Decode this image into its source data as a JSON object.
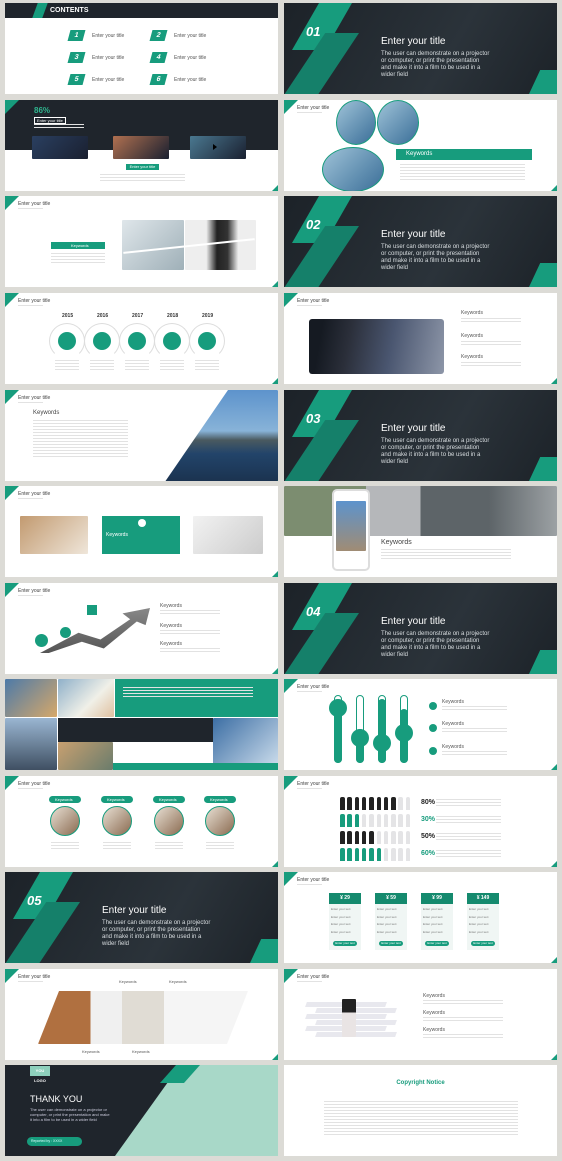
{
  "colors": {
    "accent": "#179c7d",
    "dark": "#1f252c",
    "background": "#dcdbd6"
  },
  "generic_title": "Enter your title",
  "keyword": "Keywords",
  "contents": {
    "header": "CONTENTS",
    "items": [
      {
        "n": "1",
        "label": "Enter your title"
      },
      {
        "n": "2",
        "label": "Enter your title"
      },
      {
        "n": "3",
        "label": "Enter your title"
      },
      {
        "n": "4",
        "label": "Enter your title"
      },
      {
        "n": "5",
        "label": "Enter your title"
      },
      {
        "n": "6",
        "label": "Enter your title"
      }
    ]
  },
  "sections": [
    {
      "number": "01",
      "title": "Enter your title",
      "body": "The user can demonstrate on a projector or computer, or print the presentation and make it into a film to be used in a wider field"
    },
    {
      "number": "02",
      "title": "Enter your title",
      "body": "The user can demonstrate on a projector or computer, or print the presentation and make it into a film to be used in a wider field"
    },
    {
      "number": "03",
      "title": "Enter your title",
      "body": "The user can demonstrate on a projector or computer, or print the presentation and make it into a film to be used in a wider field"
    },
    {
      "number": "04",
      "title": "Enter your title",
      "body": "The user can demonstrate on a projector or computer, or print the presentation and make it into a film to be used in a wider field"
    },
    {
      "number": "05",
      "title": "Enter your title",
      "body": "The user can demonstrate on a projector or computer, or print the presentation and make it into a film to be used in a wider field"
    }
  ],
  "stat_slide": {
    "percent": "86%",
    "title": "Enter your title",
    "button": "Enter your title"
  },
  "timeline": {
    "years": [
      "2015",
      "2016",
      "2017",
      "2018",
      "2019"
    ]
  },
  "people_chart": {
    "rows": [
      {
        "percent": "80%",
        "value": 8,
        "color": "dark"
      },
      {
        "percent": "30%",
        "value": 3,
        "color": "green"
      },
      {
        "percent": "50%",
        "value": 5,
        "color": "dark"
      },
      {
        "percent": "60%",
        "value": 6,
        "color": "green"
      }
    ]
  },
  "pricing": {
    "prices": [
      "¥ 29",
      "¥ 59",
      "¥ 99",
      "¥ 149"
    ],
    "row_label": "Enter your text",
    "button": "Enter your text"
  },
  "thank_you": {
    "logo": "YOU LOGO",
    "title": "THANK YOU",
    "body": "The user can demonstrate on a projector or computer, or print the presentation and make it into a film to be used in a wider field",
    "reporter": "Reported by : XXXX"
  },
  "copyright": {
    "title": "Copyright Notice"
  }
}
